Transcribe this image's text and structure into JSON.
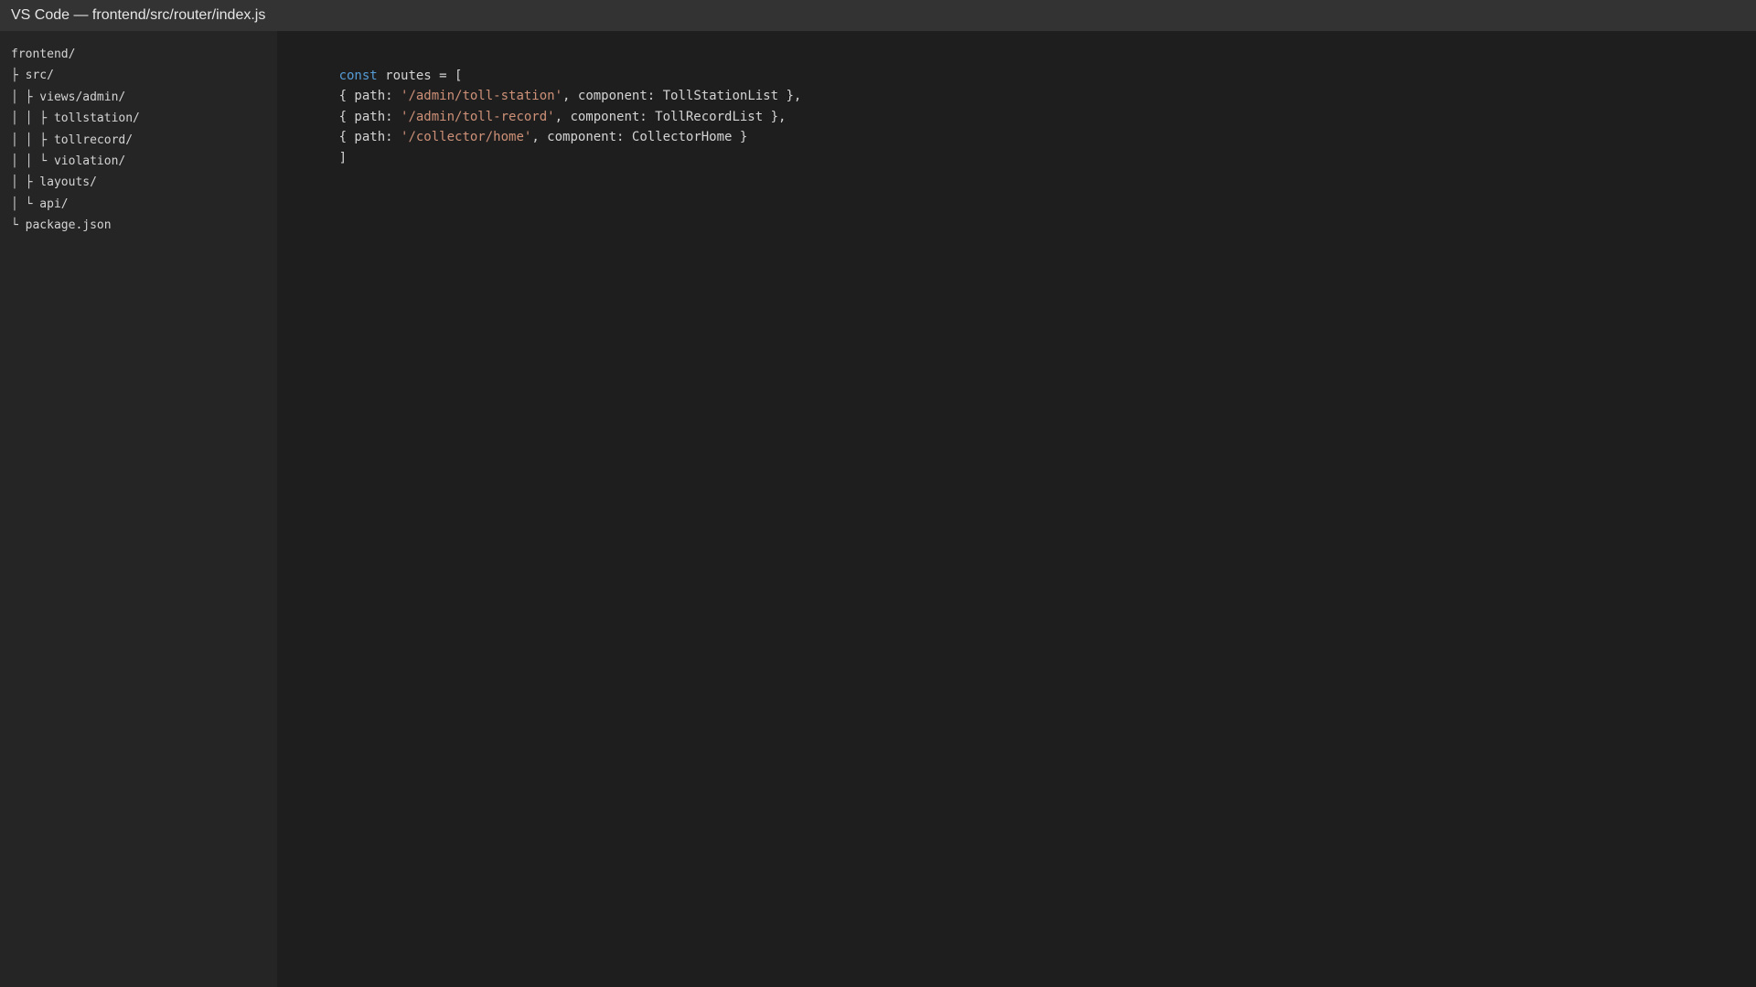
{
  "window": {
    "title": "VS Code — frontend/src/router/index.js"
  },
  "explorer": {
    "lines": [
      "frontend/",
      "├ src/",
      "│ ├ views/admin/",
      "│ │ ├ tollstation/",
      "│ │ ├ tollrecord/",
      "│ │ └ violation/",
      "│ ├ layouts/",
      "│ └ api/",
      "└ package.json"
    ]
  },
  "editor": {
    "file": "index.js",
    "lines": [
      [
        {
          "t": "const",
          "c": "kw"
        },
        {
          "t": " routes = [",
          "c": "plain"
        }
      ],
      [
        {
          "t": "{ path: ",
          "c": "plain"
        },
        {
          "t": "'/admin/toll-station'",
          "c": "str"
        },
        {
          "t": ", component: TollStationList },",
          "c": "plain"
        }
      ],
      [
        {
          "t": "{ path: ",
          "c": "plain"
        },
        {
          "t": "'/admin/toll-record'",
          "c": "str"
        },
        {
          "t": ", component: TollRecordList },",
          "c": "plain"
        }
      ],
      [
        {
          "t": "{ path: ",
          "c": "plain"
        },
        {
          "t": "'/collector/home'",
          "c": "str"
        },
        {
          "t": ", component: CollectorHome }",
          "c": "plain"
        }
      ],
      [
        {
          "t": "]",
          "c": "plain"
        }
      ]
    ]
  },
  "colors": {
    "titlebar_bg": "#333333",
    "sidebar_bg": "#252526",
    "editor_bg": "#1e1e1e",
    "keyword": "#569cd6",
    "string": "#ce9178",
    "text": "#d4d4d4"
  }
}
